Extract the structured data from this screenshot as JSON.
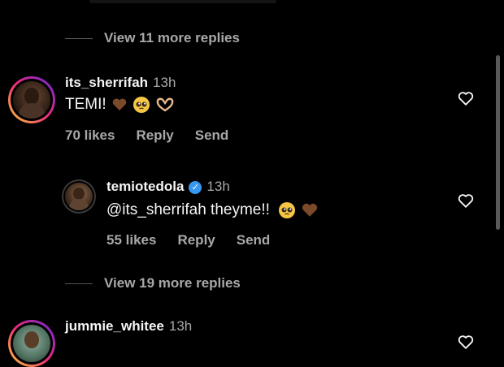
{
  "view_more_1": "View 11 more replies",
  "view_more_2": "View 19 more replies",
  "comments": [
    {
      "username": "its_sherrifah",
      "time": "13h",
      "text": "TEMI!",
      "emojis": [
        "brown-heart",
        "pleading-face",
        "heart-hands"
      ],
      "likes": "70 likes",
      "reply": "Reply",
      "send": "Send"
    },
    {
      "username": "temiotedola",
      "verified": true,
      "time": "13h",
      "text": "@its_sherrifah theyme!!",
      "emojis": [
        "pleading-face",
        "brown-heart"
      ],
      "likes": "55 likes",
      "reply": "Reply",
      "send": "Send"
    },
    {
      "username": "jummie_whitee",
      "time": "13h"
    }
  ],
  "colors": {
    "background": "#000000",
    "muted": "#a8a8a8",
    "verified": "#3897f0",
    "brown_heart": "#7a4a2a"
  }
}
